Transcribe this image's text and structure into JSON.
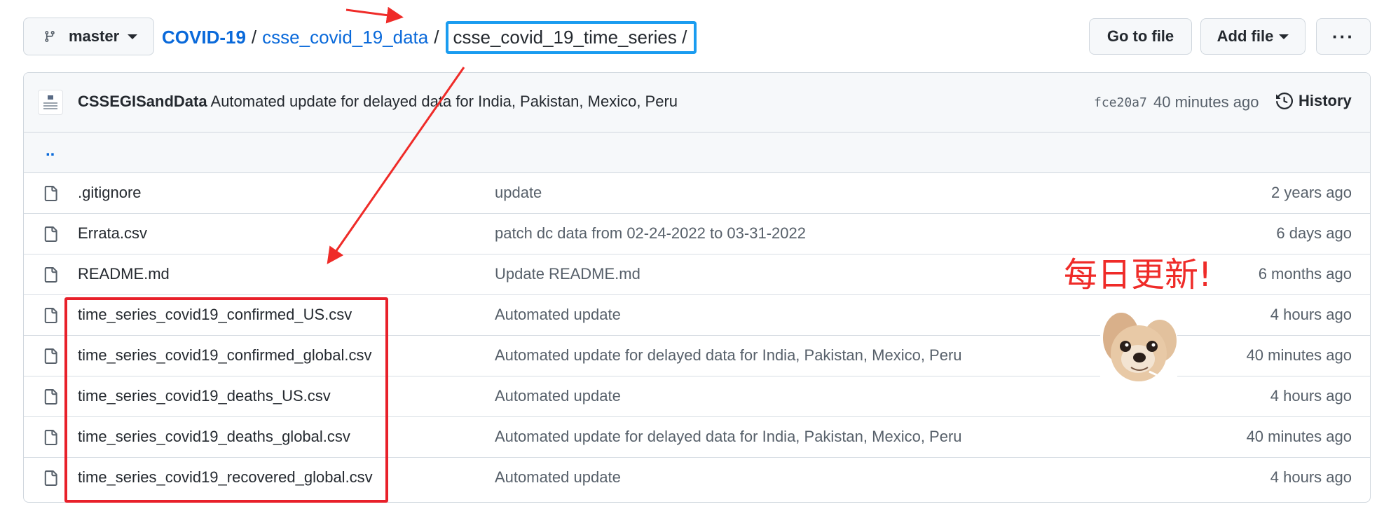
{
  "branch": {
    "label": "master",
    "icon": "git-branch-icon"
  },
  "breadcrumb": {
    "root": "COVID-19",
    "folder": "csse_covid_19_data",
    "current": "csse_covid_19_time_series",
    "separator": "/"
  },
  "toolbar": {
    "go_to_file": "Go to file",
    "add_file": "Add file",
    "more": "···"
  },
  "commit": {
    "author": "CSSEGISandData",
    "message": "Automated update for delayed data for India, Pakistan, Mexico, Peru",
    "sha": "fce20a7",
    "age": "40 minutes ago",
    "history_label": "History",
    "history_icon": "history-clock-icon"
  },
  "parent_link": "..",
  "files": [
    {
      "name": ".gitignore",
      "message": "update",
      "age": "2 years ago"
    },
    {
      "name": "Errata.csv",
      "message": "patch dc data from 02-24-2022 to 03-31-2022",
      "age": "6 days ago"
    },
    {
      "name": "README.md",
      "message": "Update README.md",
      "age": "6 months ago"
    },
    {
      "name": "time_series_covid19_confirmed_US.csv",
      "message": "Automated update",
      "age": "4 hours ago"
    },
    {
      "name": "time_series_covid19_confirmed_global.csv",
      "message": "Automated update for delayed data for India, Pakistan, Mexico, Peru",
      "age": "40 minutes ago"
    },
    {
      "name": "time_series_covid19_deaths_US.csv",
      "message": "Automated update",
      "age": "4 hours ago"
    },
    {
      "name": "time_series_covid19_deaths_global.csv",
      "message": "Automated update for delayed data for India, Pakistan, Mexico, Peru",
      "age": "40 minutes ago"
    },
    {
      "name": "time_series_covid19_recovered_global.csv",
      "message": "Automated update",
      "age": "4 hours ago"
    }
  ],
  "annotation": {
    "note": "每日更新!",
    "color": "#ef2b28",
    "highlight_color": "#1a9cf0"
  },
  "colors": {
    "link": "#0969da",
    "muted": "#57606a",
    "border": "#d0d7de"
  }
}
